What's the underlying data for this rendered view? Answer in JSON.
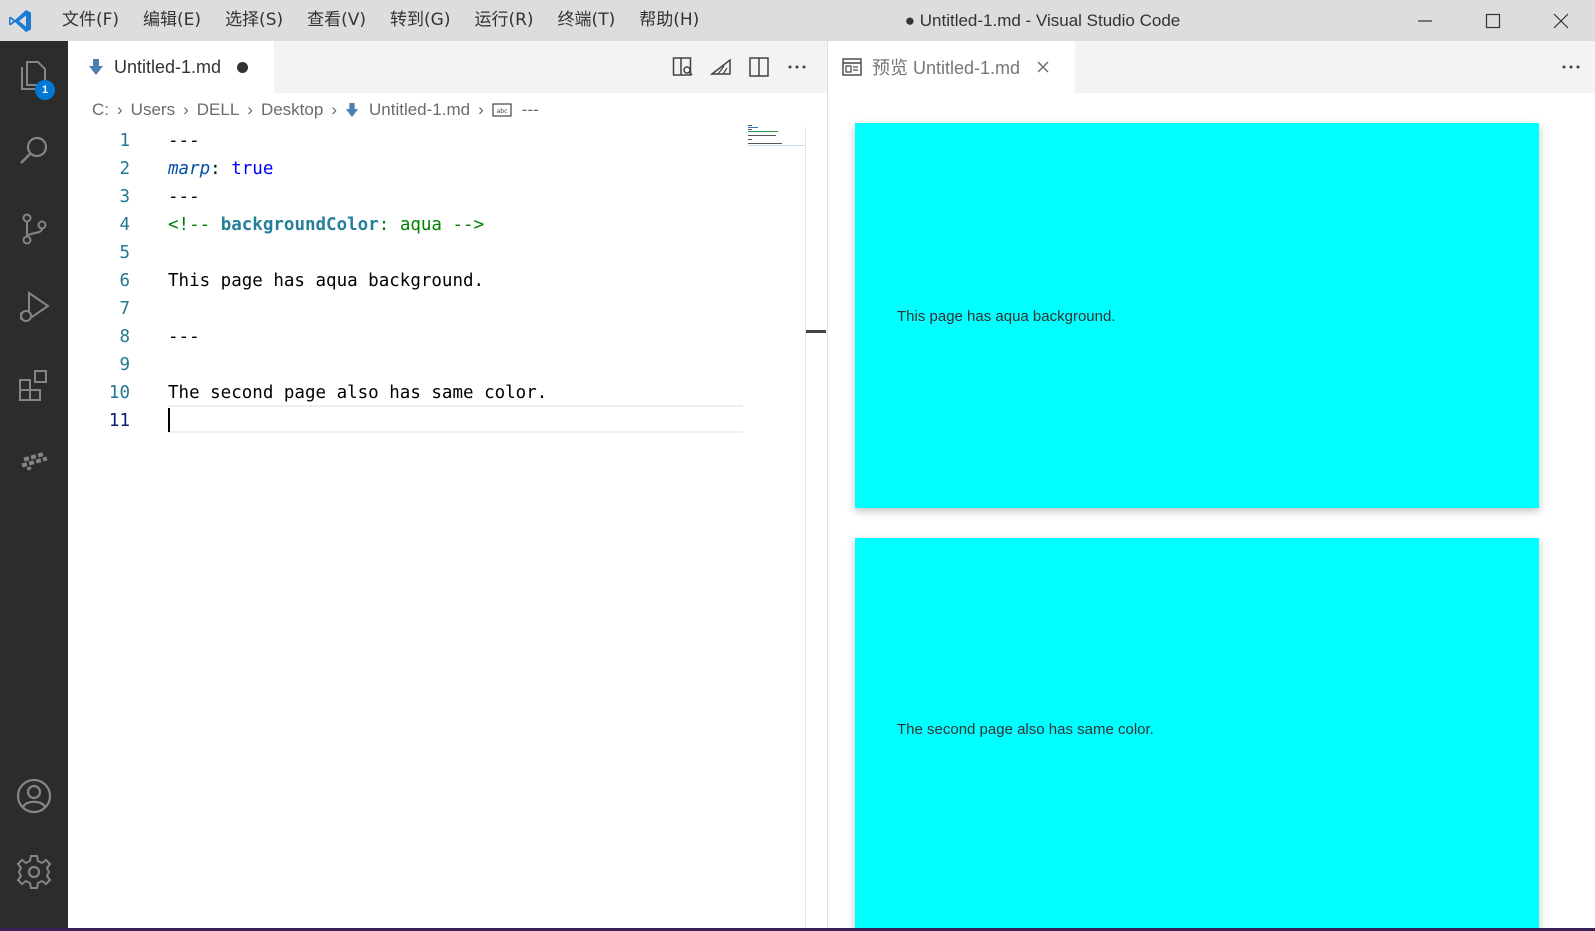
{
  "titlebar": {
    "menu": [
      "文件(F)",
      "编辑(E)",
      "选择(S)",
      "查看(V)",
      "转到(G)",
      "运行(R)",
      "终端(T)",
      "帮助(H)"
    ],
    "window_title": "● Untitled-1.md - Visual Studio Code"
  },
  "activitybar": {
    "items": [
      "files-icon",
      "search-icon",
      "source-control-icon",
      "run-debug-icon",
      "extensions-icon",
      "marp-icon"
    ],
    "explorer_badge": "1",
    "bottom_items": [
      "account-icon",
      "gear-icon"
    ]
  },
  "editor": {
    "tab_label": "Untitled-1.md",
    "breadcrumb": [
      "C:",
      "Users",
      "DELL",
      "Desktop",
      "Untitled-1.md",
      "---"
    ],
    "lines": [
      {
        "num": "1",
        "text": "---"
      },
      {
        "num": "2",
        "text": "marp: true"
      },
      {
        "num": "3",
        "text": "---"
      },
      {
        "num": "4",
        "text": "<!-- backgroundColor: aqua -->"
      },
      {
        "num": "5",
        "text": ""
      },
      {
        "num": "6",
        "text": "This page has aqua background."
      },
      {
        "num": "7",
        "text": ""
      },
      {
        "num": "8",
        "text": "---"
      },
      {
        "num": "9",
        "text": ""
      },
      {
        "num": "10",
        "text": "The second page also has same color."
      },
      {
        "num": "11",
        "text": ""
      }
    ],
    "tokens": {
      "line2_key": "marp",
      "line2_colon": ": ",
      "line2_val": "true",
      "line4_open": "<!-- ",
      "line4_prop": "backgroundColor",
      "line4_colon": ": ",
      "line4_val": "aqua",
      "line4_close": " -->"
    }
  },
  "preview": {
    "tab_label": "预览 Untitled-1.md",
    "slides": [
      {
        "text": "This page has aqua background.",
        "background": "#00ffff"
      },
      {
        "text": "The second page also has same color.",
        "background": "#00ffff"
      }
    ]
  },
  "colors": {
    "accent": "#0078d4",
    "activitybar": "#2c2c2c",
    "slide_background": "#00ffff"
  }
}
